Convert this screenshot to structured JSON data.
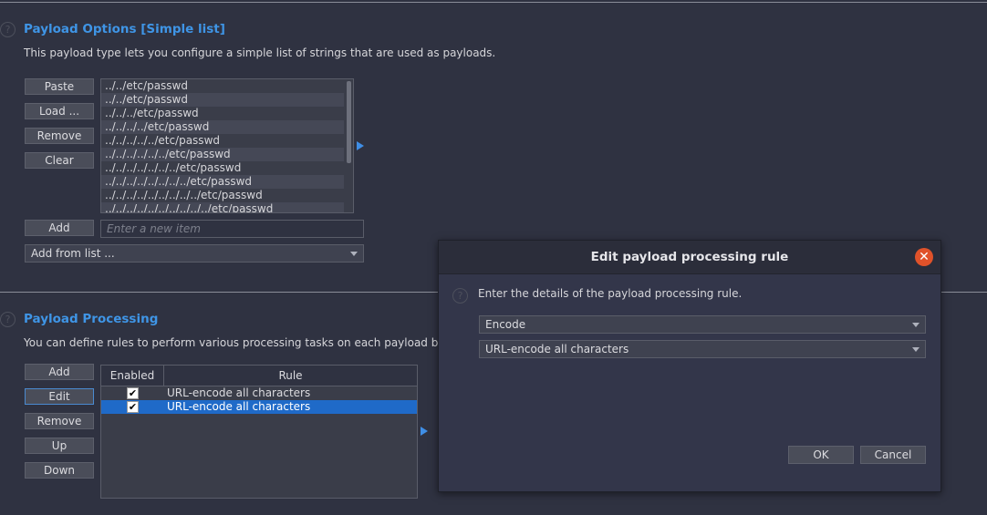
{
  "payload_options": {
    "title": "Payload Options [Simple list]",
    "description": "This payload type lets you configure a simple list of strings that are used as payloads.",
    "buttons": {
      "paste": "Paste",
      "load": "Load ...",
      "remove": "Remove",
      "clear": "Clear",
      "add": "Add"
    },
    "items": [
      "../../etc/passwd",
      "../../etc/passwd",
      "../../../etc/passwd",
      "../../../../etc/passwd",
      "../../../../../etc/passwd",
      "../../../../../../etc/passwd",
      "../../../../../../../etc/passwd",
      "../../../../../../../../etc/passwd",
      "../../../../../../../../../etc/passwd",
      "../../../../../../../../../../etc/passwd"
    ],
    "new_item_placeholder": "Enter a new item",
    "add_from_list": "Add from list ..."
  },
  "payload_processing": {
    "title": "Payload Processing",
    "description": "You can define rules to perform various processing tasks on each payload before it",
    "buttons": {
      "add": "Add",
      "edit": "Edit",
      "remove": "Remove",
      "up": "Up",
      "down": "Down"
    },
    "columns": {
      "enabled": "Enabled",
      "rule": "Rule"
    },
    "rows": [
      {
        "enabled": true,
        "rule": "URL-encode all characters",
        "selected": false
      },
      {
        "enabled": true,
        "rule": "URL-encode all characters",
        "selected": true
      }
    ]
  },
  "dialog": {
    "title": "Edit payload processing rule",
    "instructions": "Enter the details of the payload processing rule.",
    "rule_type": "Encode",
    "rule_option": "URL-encode all characters",
    "ok": "OK",
    "cancel": "Cancel"
  },
  "icons": {
    "help": "help-icon",
    "close": "close-icon",
    "expand": "arrow-right-icon",
    "dropdown": "chevron-down-icon",
    "check": "✔"
  },
  "colors": {
    "accent": "#3f95e6",
    "selection": "#1f6ac8",
    "close_button": "#e0522a",
    "background": "#2f3241"
  }
}
